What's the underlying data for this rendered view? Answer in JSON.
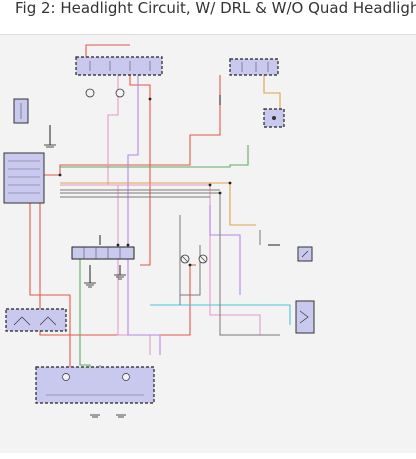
{
  "header": {
    "title": "Fig 2: Headlight Circuit, W/ DRL & W/O Quad Headlights"
  },
  "colors": {
    "page_background": "#ffffff",
    "sheet_background": "#f3f3f3",
    "component_fill": "#c9c9f0",
    "wire_red": "#e15a4a",
    "wire_pink": "#e59ac8",
    "wire_violet": "#b784e6",
    "wire_green": "#5fae5f",
    "wire_orange": "#e2a24a",
    "wire_cyan": "#4fc3d8",
    "wire_gray": "#7a7a7a",
    "wire_black": "#202020"
  },
  "components": [
    "fuse-block-top",
    "relay-block-top-right",
    "module-small-right",
    "fuse-small-left",
    "body-control-module-left",
    "junction-connector-middle",
    "headlamp-switch",
    "multifunction-switch",
    "instrument-cluster-bottom",
    "headlamp-left",
    "headlamp-right",
    "dimmer-relay-right"
  ]
}
